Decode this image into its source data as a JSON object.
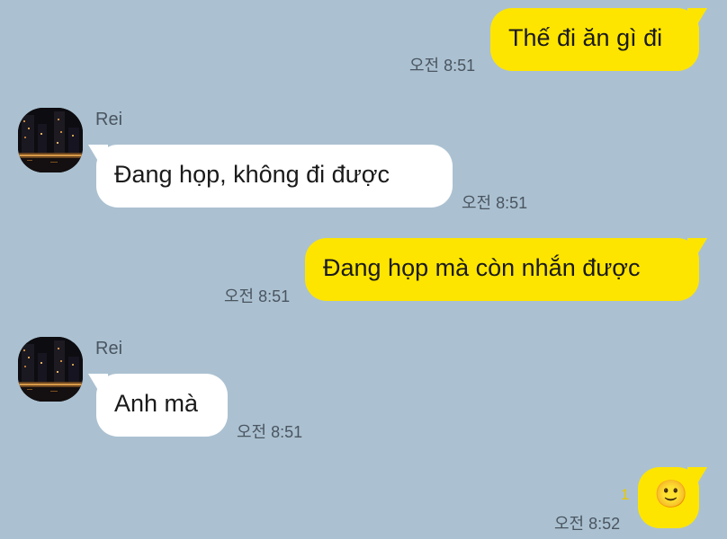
{
  "messages": [
    {
      "direction": "out",
      "text": "Thế đi ăn gì đi",
      "time": "오전 8:51"
    },
    {
      "direction": "in",
      "sender": "Rei",
      "text": "Đang họp, không đi được",
      "time": "오전 8:51"
    },
    {
      "direction": "out",
      "text": "Đang họp mà còn nhắn được",
      "time": "오전 8:51"
    },
    {
      "direction": "in",
      "sender": "Rei",
      "text": "Anh mà",
      "time": "오전 8:51"
    },
    {
      "direction": "out",
      "emoji": "🙂",
      "emoji_icon": "smiling-face-emoji-icon",
      "unread": "1",
      "time": "오전 8:52"
    }
  ],
  "colors": {
    "background": "#abc1d1",
    "outgoing_bubble": "#fee500",
    "incoming_bubble": "#ffffff",
    "unread_count": "#e8c700"
  }
}
